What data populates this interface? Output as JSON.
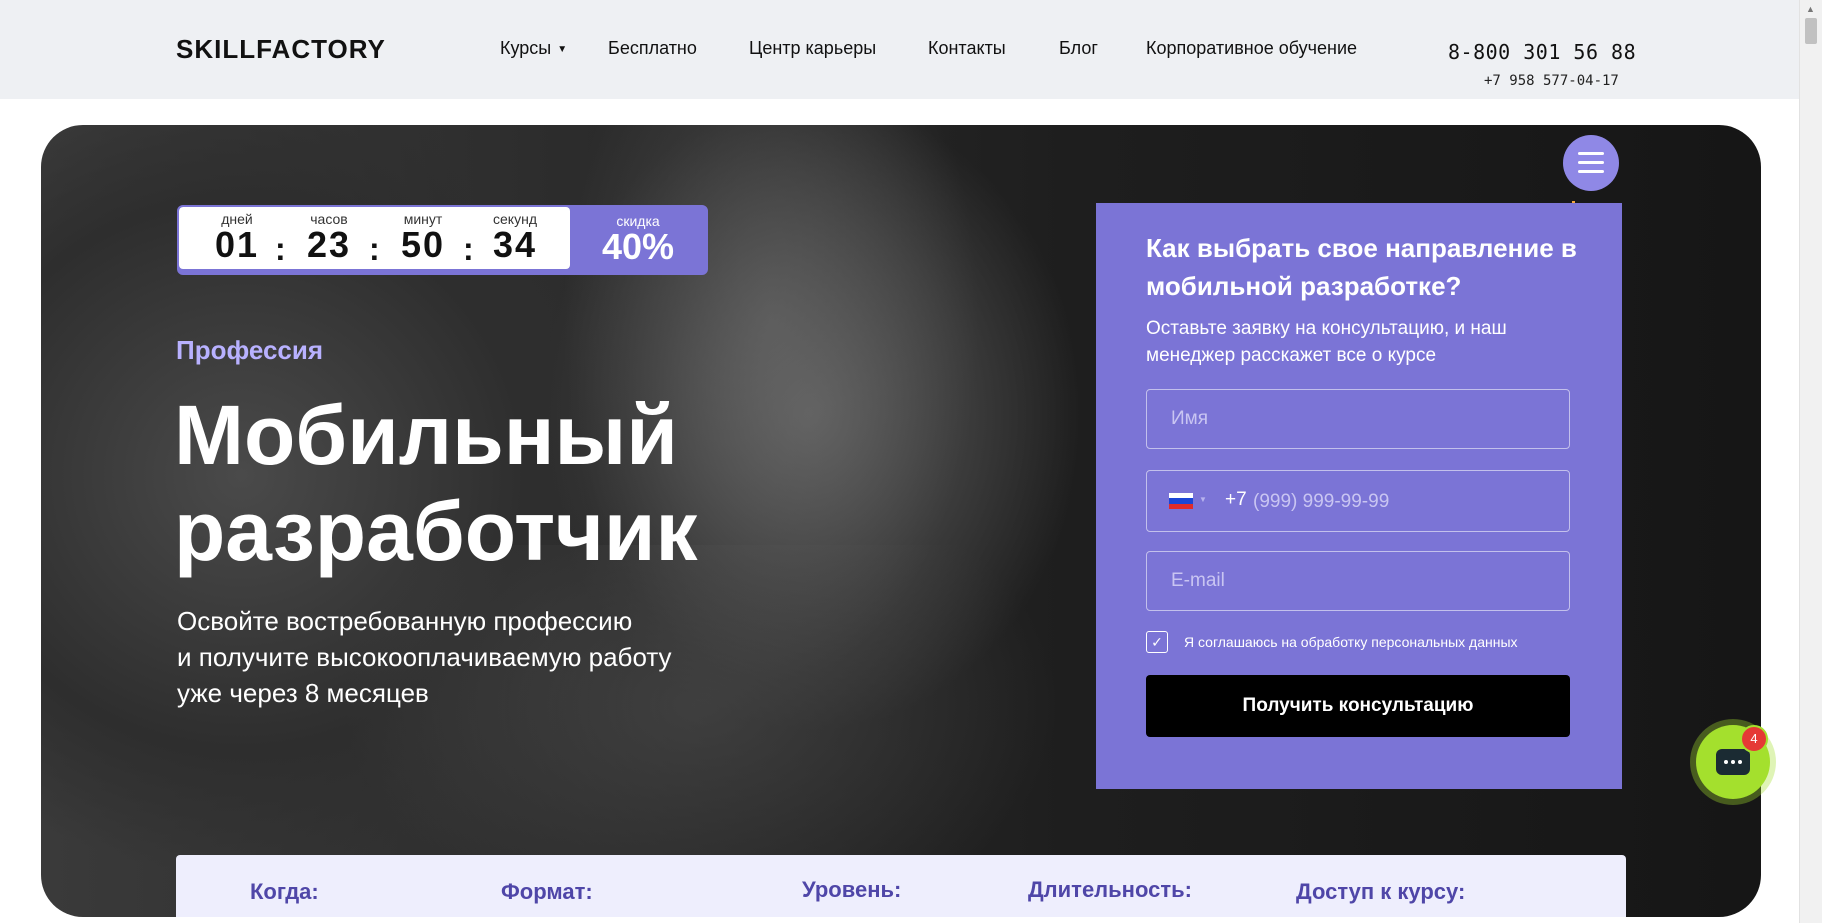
{
  "header": {
    "logo": "SKILLFACTORY",
    "nav": [
      {
        "label": "Курсы",
        "has_caret": true
      },
      {
        "label": "Бесплатно"
      },
      {
        "label": "Центр карьеры"
      },
      {
        "label": "Контакты"
      },
      {
        "label": "Блог"
      },
      {
        "label": "Корпоративное обучение"
      }
    ],
    "phone_main": "8-800 301 56 88",
    "phone_alt": "+7 958 577-04-17"
  },
  "timer": {
    "days_label": "дней",
    "days": "01",
    "hours_label": "часов",
    "hours": "23",
    "minutes_label": "минут",
    "minutes": "50",
    "seconds_label": "секунд",
    "seconds": "34",
    "separator": ":",
    "discount_label": "скидка",
    "discount": "40%"
  },
  "hero": {
    "eyebrow": "Профессия",
    "title_line1": "Мобильный",
    "title_line2": "разработчик",
    "subtitle_line1": "Освойте востребованную профессию",
    "subtitle_line2": "и получите высокооплачиваемую работу",
    "subtitle_line3": "уже через 8 месяцев"
  },
  "form": {
    "title": "Как выбрать свое направление в мобильной разработке?",
    "subtitle": "Оставьте заявку на консультацию, и наш менеджер расскажет все о курсе",
    "name_placeholder": "Имя",
    "phone_prefix": "+7",
    "phone_placeholder": "(999) 999-99-99",
    "email_placeholder": "E-mail",
    "consent": "Я соглашаюсь на обработку персональных данных",
    "consent_checked": true,
    "submit": "Получить консультацию"
  },
  "info": [
    {
      "label": "Когда:"
    },
    {
      "label": "Формат:"
    },
    {
      "label": "Уровень:"
    },
    {
      "label": "Длительность:"
    },
    {
      "label": "Доступ к курсу:"
    }
  ],
  "chat": {
    "badge": "4"
  },
  "colors": {
    "accent": "#7b74d6",
    "chat": "#a4e02d",
    "badge": "#e53935"
  }
}
